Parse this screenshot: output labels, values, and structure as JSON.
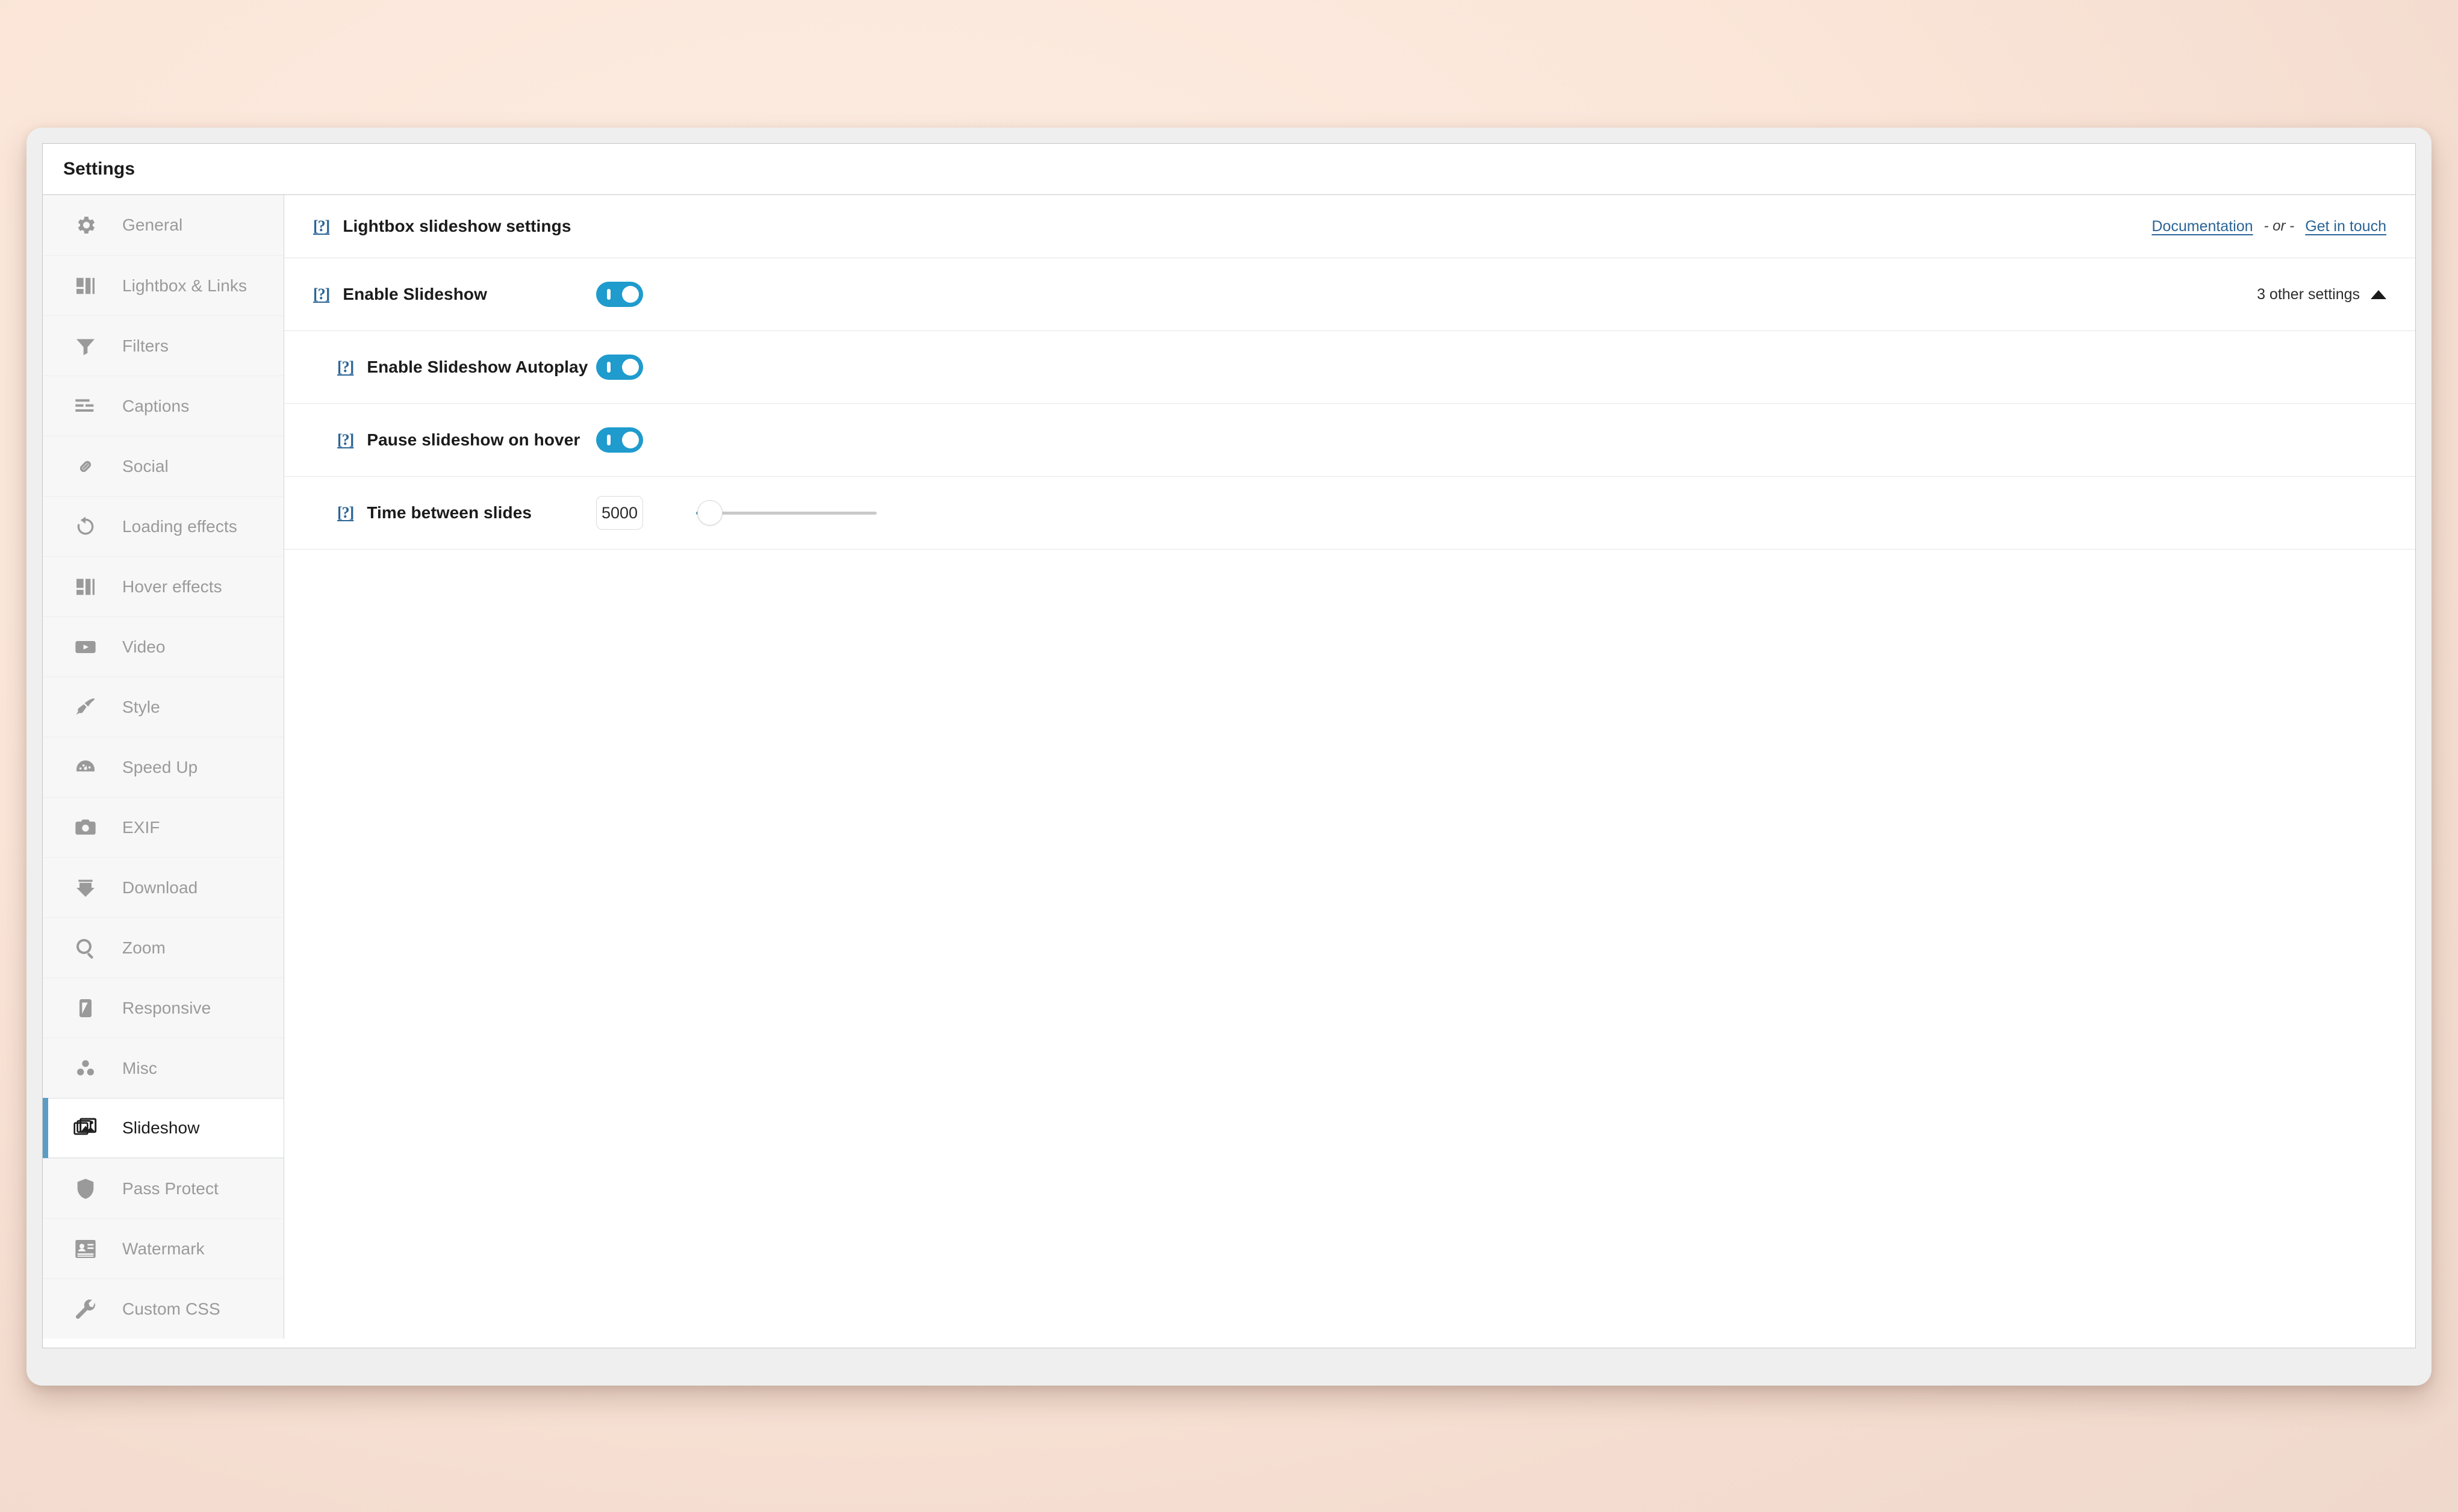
{
  "window": {
    "title": "Settings"
  },
  "sidebar": {
    "items": [
      {
        "label": "General",
        "icon": "gear-icon",
        "active": false
      },
      {
        "label": "Lightbox & Links",
        "icon": "layout-icon",
        "active": false
      },
      {
        "label": "Filters",
        "icon": "funnel-icon",
        "active": false
      },
      {
        "label": "Captions",
        "icon": "text-lines-icon",
        "active": false
      },
      {
        "label": "Social",
        "icon": "link-icon",
        "active": false
      },
      {
        "label": "Loading effects",
        "icon": "refresh-icon",
        "active": false
      },
      {
        "label": "Hover effects",
        "icon": "layout-icon",
        "active": false
      },
      {
        "label": "Video",
        "icon": "play-icon",
        "active": false
      },
      {
        "label": "Style",
        "icon": "paintbrush-icon",
        "active": false
      },
      {
        "label": "Speed Up",
        "icon": "gauge-icon",
        "active": false
      },
      {
        "label": "EXIF",
        "icon": "camera-icon",
        "active": false
      },
      {
        "label": "Download",
        "icon": "download-icon",
        "active": false
      },
      {
        "label": "Zoom",
        "icon": "magnifier-icon",
        "active": false
      },
      {
        "label": "Responsive",
        "icon": "mobile-icon",
        "active": false
      },
      {
        "label": "Misc",
        "icon": "dots-cluster-icon",
        "active": false
      },
      {
        "label": "Slideshow",
        "icon": "slideshow-icon",
        "active": true
      },
      {
        "label": "Pass Protect",
        "icon": "shield-icon",
        "active": false
      },
      {
        "label": "Watermark",
        "icon": "watermark-icon",
        "active": false
      },
      {
        "label": "Custom CSS",
        "icon": "wrench-icon",
        "active": false
      }
    ]
  },
  "main": {
    "section": {
      "help_icon": "[?]",
      "title": "Lightbox slideshow settings",
      "documentation_link": "Documentation",
      "separator": "- or -",
      "contact_link": "Get in touch"
    },
    "settings": [
      {
        "help_icon": "[?]",
        "label": "Enable Slideshow",
        "control": "toggle",
        "value": "on",
        "other_settings_label": "3 other settings",
        "other_settings_expanded": true,
        "indent": false
      },
      {
        "help_icon": "[?]",
        "label": "Enable Slideshow Autoplay",
        "control": "toggle",
        "value": "on",
        "indent": true
      },
      {
        "help_icon": "[?]",
        "label": "Pause slideshow on hover",
        "control": "toggle",
        "value": "on",
        "indent": true
      },
      {
        "help_icon": "[?]",
        "label": "Time between slides",
        "control": "number-slider",
        "value": "5000",
        "slider_position_percent": 1,
        "indent": true
      }
    ]
  },
  "colors": {
    "toggle_on": "#1f9bcd",
    "link": "#2a6496",
    "active_accent": "#5b9dc4",
    "page_background": "#fbe6d9"
  }
}
